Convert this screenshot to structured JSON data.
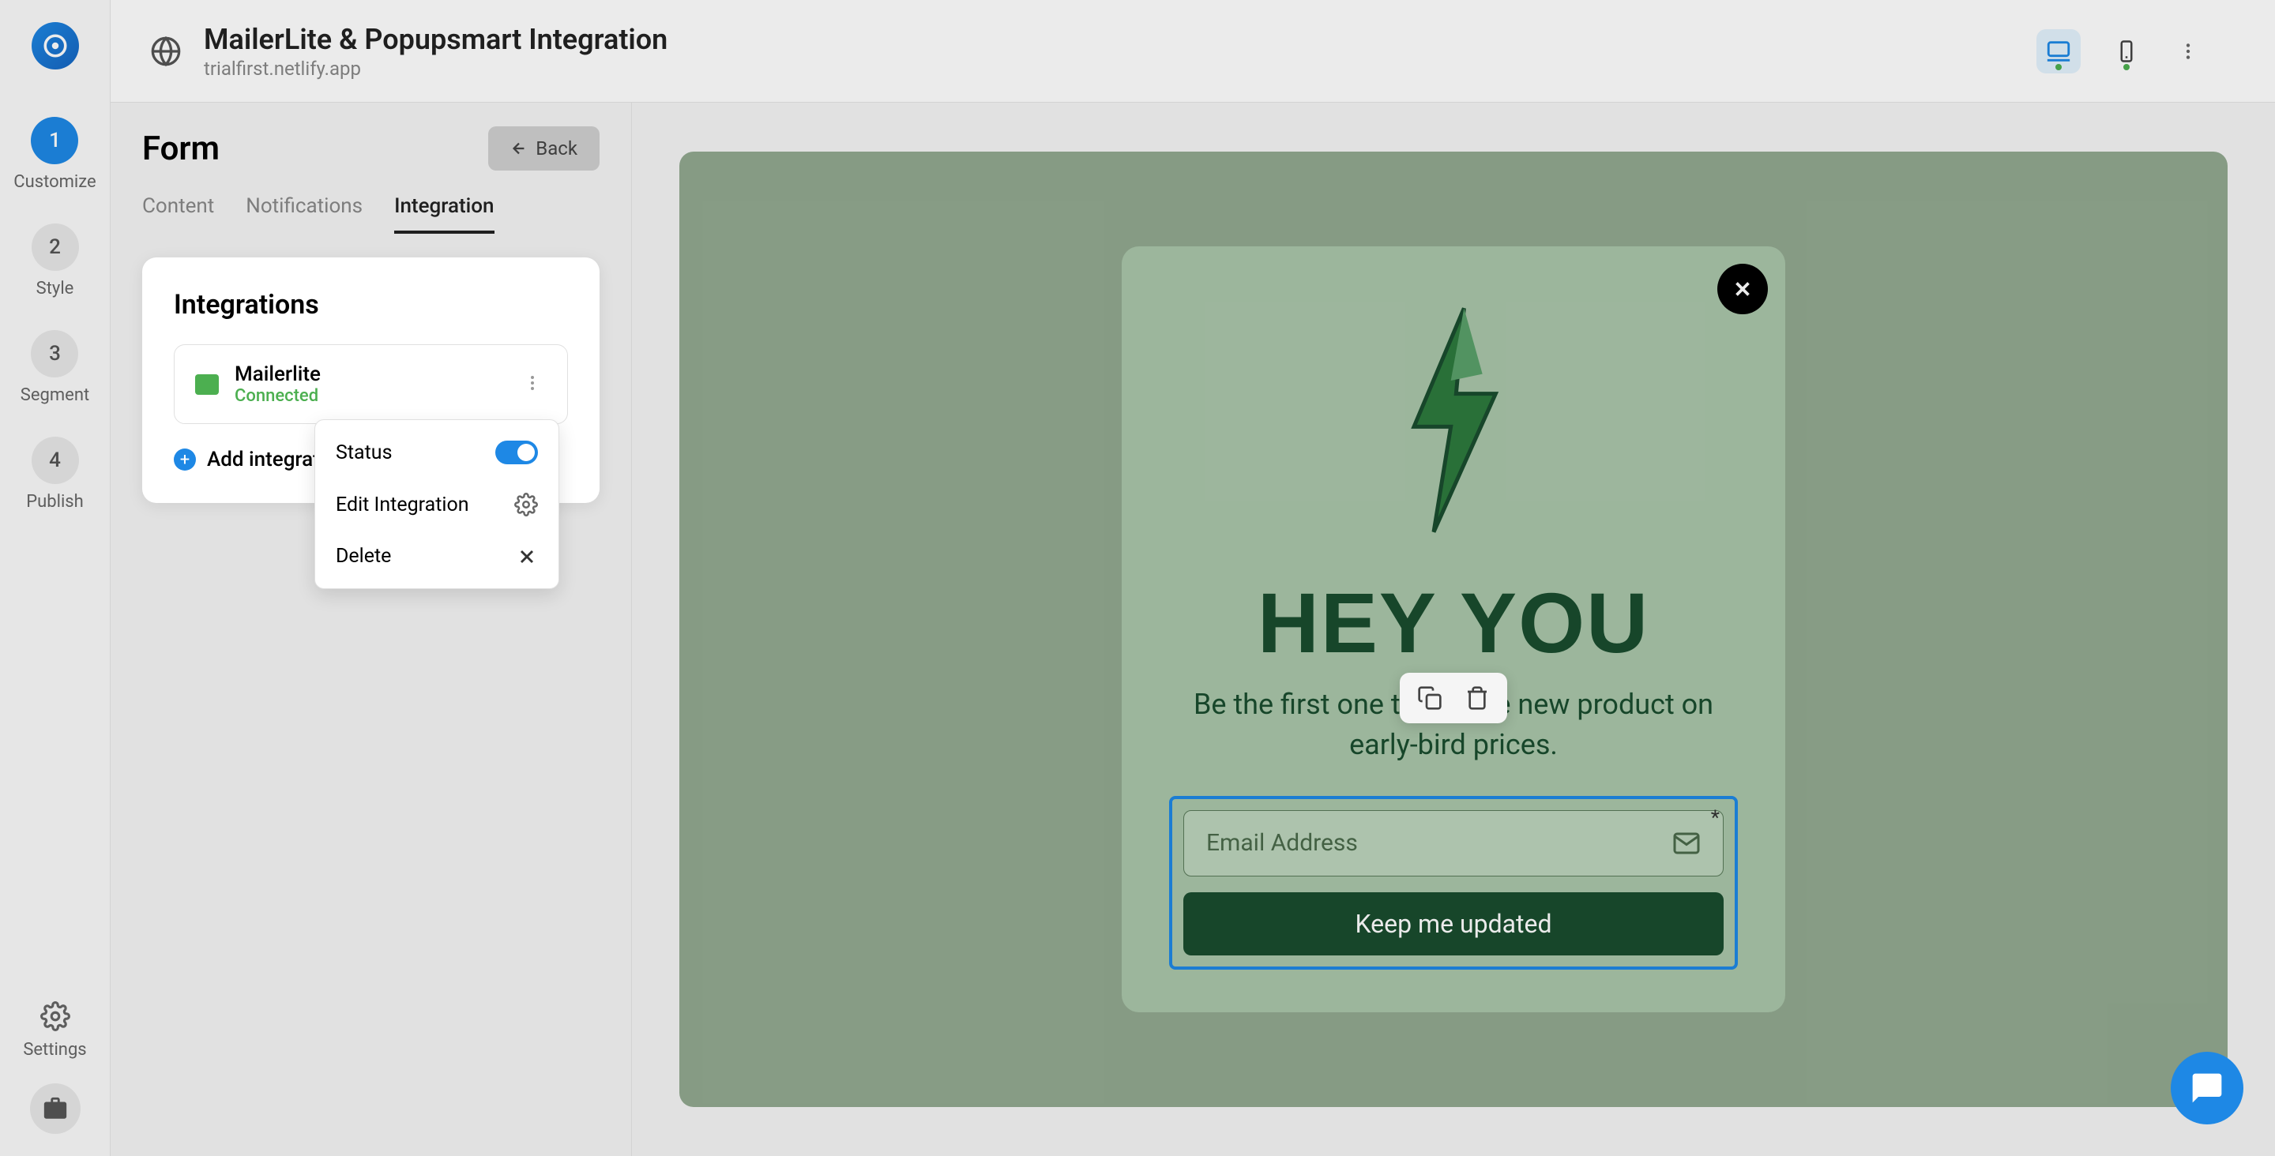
{
  "header": {
    "title": "MailerLite & Popupsmart Integration",
    "subtitle": "trialfirst.netlify.app"
  },
  "rail": {
    "steps": [
      {
        "num": "1",
        "label": "Customize"
      },
      {
        "num": "2",
        "label": "Style"
      },
      {
        "num": "3",
        "label": "Segment"
      },
      {
        "num": "4",
        "label": "Publish"
      }
    ],
    "settings_label": "Settings"
  },
  "panel": {
    "title": "Form",
    "back_label": "Back",
    "tabs": [
      "Content",
      "Notifications",
      "Integration"
    ],
    "card_title": "Integrations",
    "integration": {
      "name": "Mailerlite",
      "status": "Connected"
    },
    "add_label": "Add integration",
    "dropdown": {
      "status": "Status",
      "edit": "Edit Integration",
      "delete": "Delete"
    }
  },
  "popup": {
    "title": "HEY YOU",
    "subtitle": "Be the first one to get the new product on early-bird prices.",
    "placeholder": "Email Address",
    "button": "Keep me updated"
  }
}
